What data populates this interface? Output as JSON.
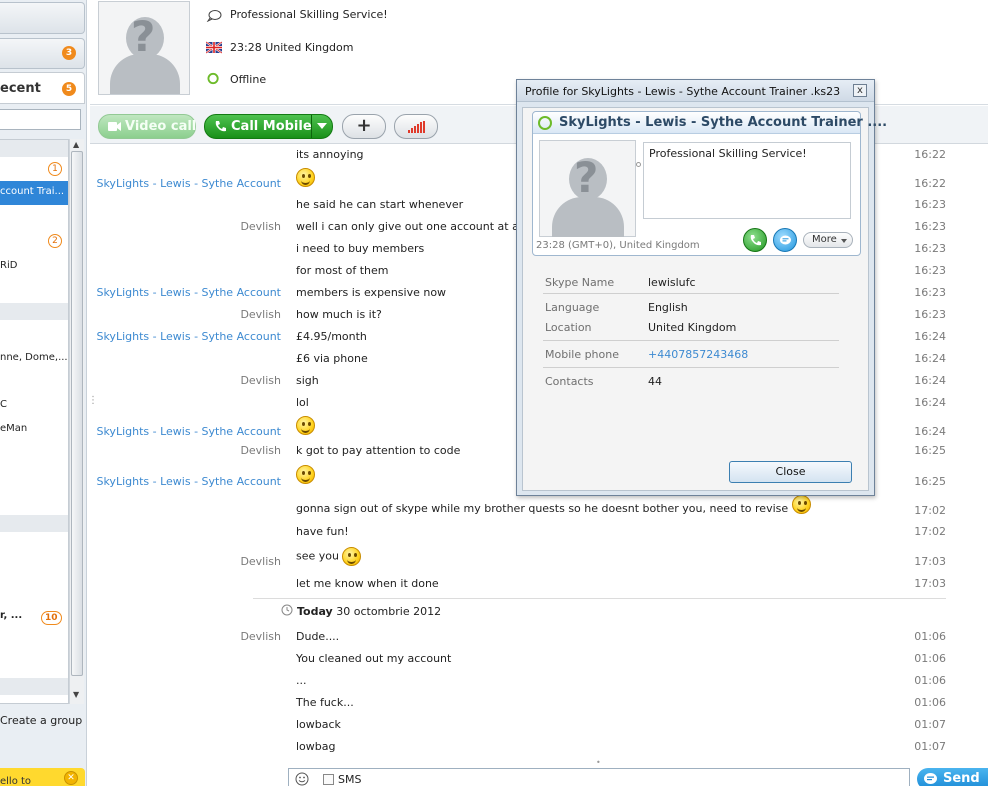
{
  "sidebar": {
    "badge_top": "3",
    "recent_title": "ecent",
    "recent_badge": "5",
    "rows": [
      {
        "label": "",
        "badge": "1"
      },
      {
        "label": "ccount Trai...",
        "badge": ""
      },
      {
        "label": "",
        "badge": "2"
      },
      {
        "label": "RiD",
        "badge": ""
      },
      {
        "label": "nne, Dome,...",
        "badge": ""
      },
      {
        "label": "C",
        "badge": ""
      },
      {
        "label": "eMan",
        "badge": ""
      },
      {
        "label": "r, ...",
        "badge": "10"
      }
    ],
    "create_group": "Create a group",
    "promo_text": "ello to"
  },
  "header": {
    "mood": "Professional Skilling Service!",
    "location": "23:28 United Kingdom",
    "status": "Offline"
  },
  "toolbar": {
    "video_call": "Video call",
    "call_mobile": "Call Mobile",
    "add": "+"
  },
  "chat": {
    "messages": [
      {
        "sender": "",
        "text": "its annoying",
        "time": "16:22",
        "sender_color": "gray",
        "smiley": false
      },
      {
        "sender": "SkyLights - Lewis - Sythe Account",
        "text": "",
        "time": "16:22",
        "sender_color": "blue",
        "smiley": true
      },
      {
        "sender": "",
        "text": "he said he can start whenever",
        "time": "16:23",
        "sender_color": "gray",
        "smiley": false
      },
      {
        "sender": "Devlish",
        "text": "well i can only give out one account at a time",
        "time": "16:23",
        "sender_color": "gray",
        "smiley": false
      },
      {
        "sender": "",
        "text": "i need to buy members",
        "time": "16:23",
        "sender_color": "gray",
        "smiley": false
      },
      {
        "sender": "",
        "text": "for most of them",
        "time": "16:23",
        "sender_color": "gray",
        "smiley": false
      },
      {
        "sender": "SkyLights - Lewis - Sythe Account",
        "text": "members is expensive now",
        "time": "16:23",
        "sender_color": "blue",
        "smiley": false
      },
      {
        "sender": "Devlish",
        "text": "how much is it?",
        "time": "16:23",
        "sender_color": "gray",
        "smiley": false
      },
      {
        "sender": "SkyLights - Lewis - Sythe Account",
        "text": "£4.95/month",
        "time": "16:24",
        "sender_color": "blue",
        "smiley": false
      },
      {
        "sender": "",
        "text": "£6 via phone",
        "time": "16:24",
        "sender_color": "gray",
        "smiley": false
      },
      {
        "sender": "Devlish",
        "text": "sigh",
        "time": "16:24",
        "sender_color": "gray",
        "smiley": false
      },
      {
        "sender": "",
        "text": "lol",
        "time": "16:24",
        "sender_color": "gray",
        "smiley": false
      },
      {
        "sender": "SkyLights - Lewis - Sythe Account",
        "text": "",
        "time": "16:24",
        "sender_color": "blue",
        "smiley": true
      },
      {
        "sender": "Devlish",
        "text": "k got to pay attention to code",
        "time": "16:25",
        "sender_color": "gray",
        "smiley": false
      },
      {
        "sender": "SkyLights - Lewis - Sythe Account",
        "text": "",
        "time": "16:25",
        "sender_color": "blue",
        "smiley": true
      },
      {
        "sender": "",
        "text": "gonna sign out of skype while my brother quests so he doesnt bother you, need to revise",
        "time": "17:02",
        "sender_color": "gray",
        "smiley": true
      },
      {
        "sender": "",
        "text": "have fun!",
        "time": "17:02",
        "sender_color": "gray",
        "smiley": false
      },
      {
        "sender": "Devlish",
        "text": "see you",
        "time": "17:03",
        "sender_color": "gray",
        "smiley": true
      },
      {
        "sender": "",
        "text": "let me know when it done",
        "time": "17:03",
        "sender_color": "gray",
        "smiley": false
      }
    ],
    "day_label_bold": "Today",
    "day_label_date": "30 octombrie 2012",
    "messages_today": [
      {
        "sender": "Devlish",
        "text": "Dude....",
        "time": "01:06"
      },
      {
        "sender": "",
        "text": "You cleaned out my account",
        "time": "01:06"
      },
      {
        "sender": "",
        "text": "...",
        "time": "01:06"
      },
      {
        "sender": "",
        "text": "The fuck...",
        "time": "01:06"
      },
      {
        "sender": "",
        "text": "lowback",
        "time": "01:07"
      },
      {
        "sender": "",
        "text": "lowbag",
        "time": "01:07"
      }
    ]
  },
  "composer": {
    "sms_label": "SMS",
    "send_label": "Send m"
  },
  "dialog": {
    "title": "Profile for SkyLights - Lewis - Sythe Account Trainer .ks23",
    "close_x": "x",
    "card_name": "SkyLights - Lewis - Sythe Account Trainer ....",
    "mood": "Professional Skilling Service!",
    "local_time": "23:28 (GMT+0), United Kingdom",
    "more_label": "More",
    "fields": [
      {
        "label": "Skype Name",
        "value": "lewislufc",
        "link": false
      },
      {
        "label": "Language",
        "value": "English",
        "link": false
      },
      {
        "label": "Location",
        "value": "United Kingdom",
        "link": false
      },
      {
        "label": "Mobile phone",
        "value": "+4407857243468",
        "link": true
      },
      {
        "label": "Contacts",
        "value": "44",
        "link": false
      }
    ],
    "close_button": "Close"
  },
  "colors": {
    "accent_blue": "#3d8ad1",
    "call_green": "#199019",
    "badge_orange": "#f08a1c",
    "status_green": "#6dbb2a"
  },
  "icons": {
    "mood": "speech-bubble-icon",
    "flag": "uk-flag-icon",
    "status": "offline-status-icon",
    "video": "video-camera-icon",
    "call": "phone-icon",
    "signal": "signal-bars-icon",
    "emoticon": "smiley-icon",
    "send": "chat-bubble-icon"
  }
}
